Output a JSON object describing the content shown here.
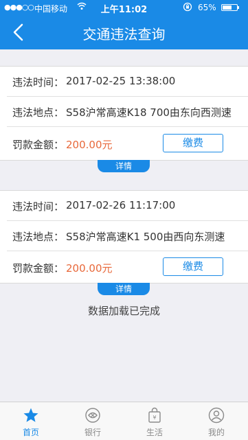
{
  "status_bar": {
    "signal": "●●●○○",
    "carrier": "中国移动",
    "time": "上午11:02",
    "battery": "65%",
    "battery_level": 0.65
  },
  "nav": {
    "title": "交通违法查询"
  },
  "violations": [
    {
      "time_label": "违法时间：",
      "time_value": "2017-02-25 13:38:00",
      "place_label": "违法地点：",
      "place_value": "S58沪常高速K18 700由东向西测速",
      "fine_label": "罚款金额：",
      "fine_value": "200.00元",
      "pay_label": "缴费",
      "detail_label": "详情"
    },
    {
      "time_label": "违法时间：",
      "time_value": "2017-02-26 11:17:00",
      "place_label": "违法地点：",
      "place_value": "S58沪常高速K1 500由西向东测速",
      "fine_label": "罚款金额：",
      "fine_value": "200.00元",
      "pay_label": "缴费",
      "detail_label": "详情"
    }
  ],
  "load_status": "数据加载已完成",
  "tab_bar": {
    "tabs": [
      {
        "label": "首页",
        "icon": "star-icon"
      },
      {
        "label": "银行",
        "icon": "bank-icon"
      },
      {
        "label": "生活",
        "icon": "shopping-bag-icon"
      },
      {
        "label": "我的",
        "icon": "user-icon"
      }
    ],
    "active_color": "#1a8ae6"
  },
  "colors": {
    "brand": "#1a8ae6",
    "amount": "#e8683a"
  }
}
